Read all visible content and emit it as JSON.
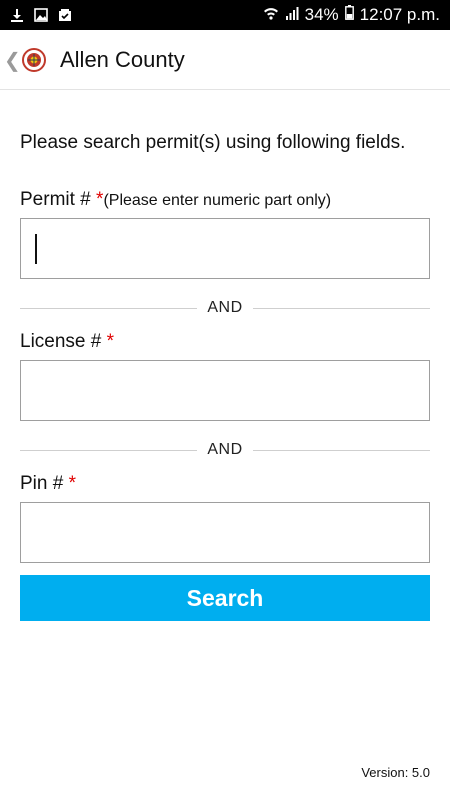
{
  "status_bar": {
    "battery": "34%",
    "time": "12:07 p.m.",
    "icons": [
      "download-icon",
      "image-icon",
      "gallery-check-icon",
      "wifi-icon",
      "signal-icon",
      "battery-icon"
    ]
  },
  "app_bar": {
    "title": "Allen County",
    "logo_text_top": "INSPECTION",
    "logo_text_bottom": "REQUEST"
  },
  "form": {
    "intro": "Please search permit(s) using following fields.",
    "permit_label": "Permit #",
    "permit_hint": "(Please enter numeric part only)",
    "permit_value": "",
    "license_label": "License #",
    "license_value": "",
    "pin_label": "Pin #",
    "pin_value": "",
    "required_mark": "*",
    "divider_text": "AND",
    "search_label": "Search"
  },
  "footer": {
    "version": "Version: 5.0"
  },
  "colors": {
    "accent": "#00aeef",
    "required": "#e00000",
    "status_bar": "#000000"
  }
}
